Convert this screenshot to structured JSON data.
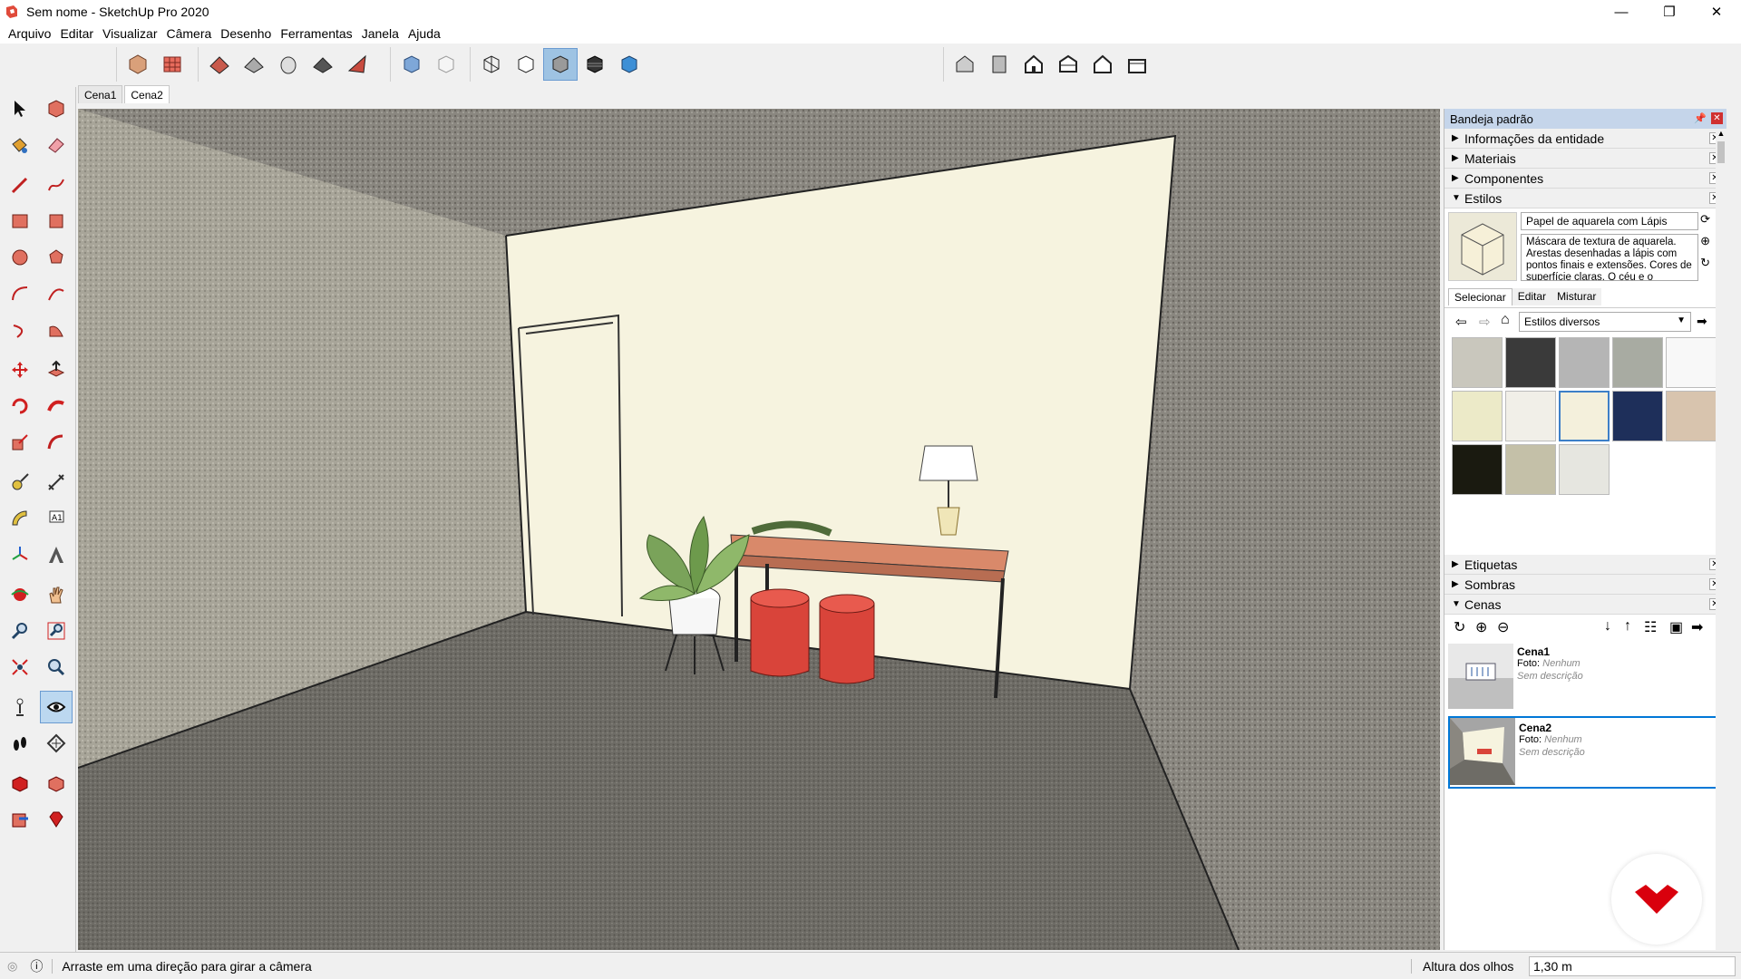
{
  "window": {
    "title": "Sem nome - SketchUp Pro 2020",
    "minimize": "—",
    "maximize": "❐",
    "close": "✕"
  },
  "menu": [
    "Arquivo",
    "Editar",
    "Visualizar",
    "Câmera",
    "Desenho",
    "Ferramentas",
    "Janela",
    "Ajuda"
  ],
  "scene_tabs": [
    {
      "label": "Cena1"
    },
    {
      "label": "Cena2"
    }
  ],
  "tray": {
    "title": "Bandeja padrão",
    "panels_top": [
      {
        "label": "Informações da entidade",
        "expanded": false
      },
      {
        "label": "Materiais",
        "expanded": false
      },
      {
        "label": "Componentes",
        "expanded": false
      },
      {
        "label": "Estilos",
        "expanded": true
      }
    ],
    "styles": {
      "name": "Papel de aquarela com Lápis",
      "description": "Máscara de textura de aquarela. Arestas desenhadas a lápis com pontos finais e extensões. Cores de superfície claras. O céu e o",
      "tabs": [
        "Selecionar",
        "Editar",
        "Misturar"
      ],
      "collection": "Estilos diversos"
    },
    "panels_bottom": [
      {
        "label": "Etiquetas",
        "expanded": false
      },
      {
        "label": "Sombras",
        "expanded": false
      },
      {
        "label": "Cenas",
        "expanded": true
      }
    ],
    "scenes": [
      {
        "name": "Cena1",
        "photo_label": "Foto:",
        "photo_value": "Nenhum",
        "description": "Sem descrição"
      },
      {
        "name": "Cena2",
        "photo_label": "Foto:",
        "photo_value": "Nenhum",
        "description": "Sem descrição"
      }
    ]
  },
  "status": {
    "message": "Arraste em uma direção para girar a câmera",
    "measure_label": "Altura dos olhos",
    "measure_value": "1,30 m"
  },
  "colors": {
    "accent": "#0078d7",
    "selection": "#9ec3e3",
    "wall": "#f6f3df",
    "floor": "#6e6c66",
    "table_top": "#d9896a",
    "stool": "#d9443a"
  }
}
